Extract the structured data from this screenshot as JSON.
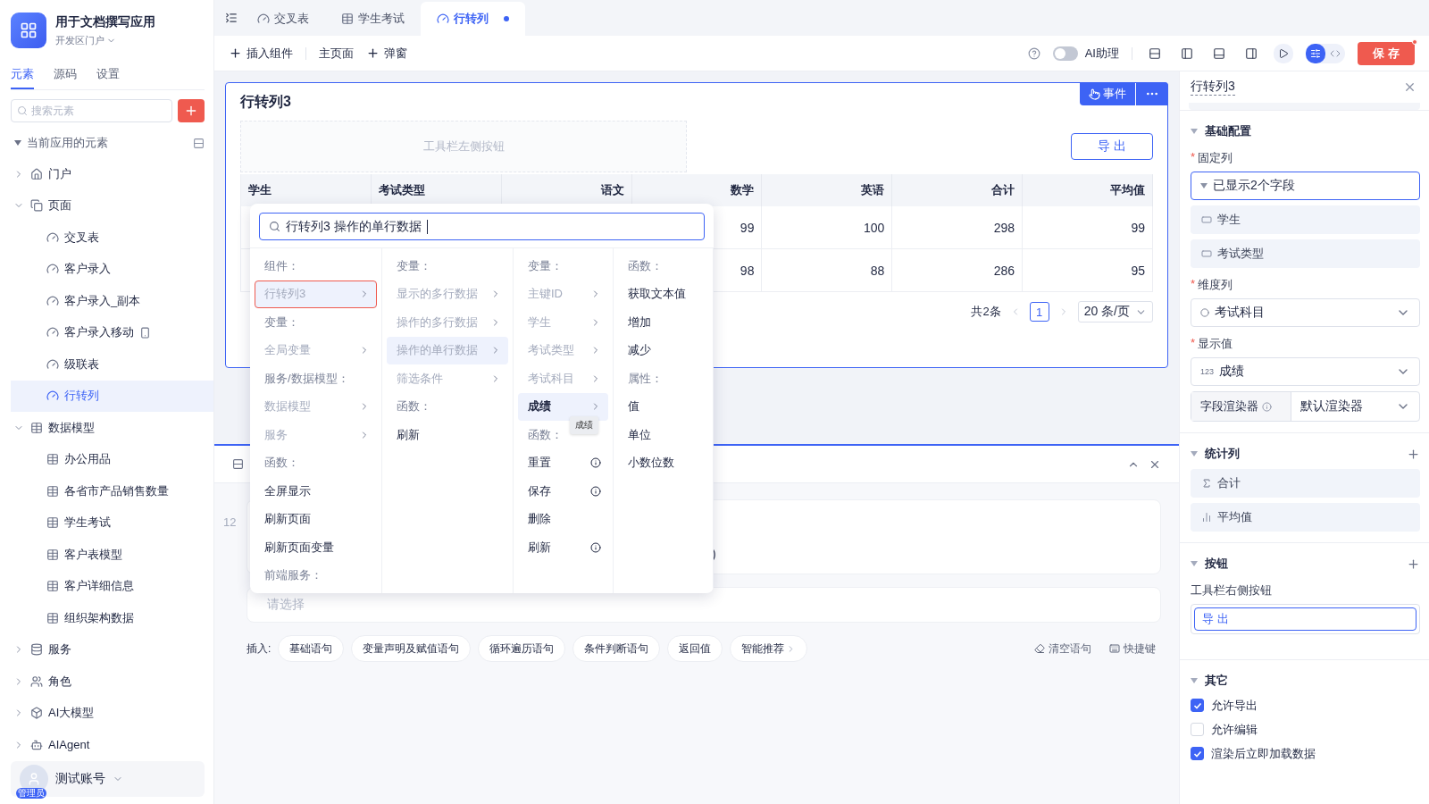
{
  "app": {
    "title": "用于文档撰写应用",
    "portal": "开发区门户"
  },
  "sidebar_tabs": [
    {
      "label": "元素",
      "selected": true
    },
    {
      "label": "源码",
      "selected": false
    },
    {
      "label": "设置",
      "selected": false
    }
  ],
  "search": {
    "placeholder": "搜索元素"
  },
  "tree_title": "当前应用的元素",
  "tree": [
    {
      "label": "门户",
      "kind": "home",
      "expanded": false
    },
    {
      "label": "页面",
      "kind": "pages",
      "expanded": true,
      "children": [
        {
          "label": "交叉表",
          "selected": false,
          "mobile": false
        },
        {
          "label": "客户录入",
          "selected": false,
          "mobile": false
        },
        {
          "label": "客户录入_副本",
          "selected": false,
          "mobile": false
        },
        {
          "label": "客户录入移动",
          "selected": false,
          "mobile": true
        },
        {
          "label": "级联表",
          "selected": false,
          "mobile": false
        },
        {
          "label": "行转列",
          "selected": true,
          "mobile": false
        }
      ]
    },
    {
      "label": "数据模型",
      "kind": "models",
      "expanded": true,
      "children": [
        {
          "label": "办公用品",
          "selected": false,
          "mobile": false
        },
        {
          "label": "各省市产品销售数量",
          "selected": false,
          "mobile": false
        },
        {
          "label": "学生考试",
          "selected": false,
          "mobile": false
        },
        {
          "label": "客户表模型",
          "selected": false,
          "mobile": false
        },
        {
          "label": "客户详细信息",
          "selected": false,
          "mobile": false
        },
        {
          "label": "组织架构数据",
          "selected": false,
          "mobile": false
        }
      ]
    },
    {
      "label": "服务",
      "kind": "services",
      "expanded": false
    },
    {
      "label": "角色",
      "kind": "roles",
      "expanded": false
    },
    {
      "label": "AI大模型",
      "kind": "ai_models",
      "expanded": false
    },
    {
      "label": "AIAgent",
      "kind": "agents",
      "expanded": false
    }
  ],
  "user": {
    "name": "测试账号",
    "role": "管理员"
  },
  "editor_tabs": [
    {
      "label": "交叉表",
      "kind": "page",
      "selected": false,
      "modified": false
    },
    {
      "label": "学生考试",
      "kind": "model",
      "selected": false,
      "modified": false
    },
    {
      "label": "行转列",
      "kind": "page",
      "selected": true,
      "modified": true
    }
  ],
  "toolbar": {
    "insert": "插入组件",
    "main_page": "主页面",
    "popup": "弹窗",
    "ai_label": "AI助理",
    "ai_on": false,
    "save": "保 存"
  },
  "component": {
    "title": "行转列3",
    "event_button": "事件",
    "toolbar_left": "工具栏左侧按钮",
    "export_button": "导 出",
    "columns": [
      "学生",
      "考试类型",
      "语文",
      "数学",
      "英语",
      "合计",
      "平均值"
    ],
    "rows": [
      {
        "cells": [
          null,
          null,
          null,
          "99",
          "100",
          "298",
          "99"
        ]
      },
      {
        "cells": [
          null,
          null,
          null,
          "98",
          "88",
          "286",
          "95"
        ]
      }
    ],
    "pagination": {
      "total": "共2条",
      "pages": [
        {
          "label": "1",
          "selected": true
        }
      ],
      "page_size": "20 条/页"
    }
  },
  "logic_panel": {
    "line_number": "12",
    "code_fragment": ")",
    "select_placeholder": "请选择",
    "insert_label": "插入:",
    "insert_buttons": [
      {
        "label": "基础语句",
        "submenu": false
      },
      {
        "label": "变量声明及赋值语句",
        "submenu": false
      },
      {
        "label": "循环遍历语句",
        "submenu": false
      },
      {
        "label": "条件判断语句",
        "submenu": false
      },
      {
        "label": "返回值",
        "submenu": false
      },
      {
        "label": "智能推荐",
        "submenu": true
      }
    ],
    "clear": "清空语句",
    "shortcut": "快捷键"
  },
  "picker": {
    "query": "行转列3 操作的单行数据",
    "tooltip": "成绩",
    "columns": [
      [
        {
          "kind": "heading",
          "label": "组件："
        },
        {
          "kind": "item",
          "label": "行转列3",
          "disabled": true,
          "selected": true,
          "submenu": true,
          "info": false,
          "outlined": true
        },
        {
          "kind": "heading",
          "label": "变量："
        },
        {
          "kind": "item",
          "label": "全局变量",
          "disabled": true,
          "selected": false,
          "submenu": true,
          "info": false,
          "outlined": false
        },
        {
          "kind": "heading",
          "label": "服务/数据模型："
        },
        {
          "kind": "item",
          "label": "数据模型",
          "disabled": true,
          "selected": false,
          "submenu": true,
          "info": false,
          "outlined": false
        },
        {
          "kind": "item",
          "label": "服务",
          "disabled": true,
          "selected": false,
          "submenu": true,
          "info": false,
          "outlined": false
        },
        {
          "kind": "heading",
          "label": "函数："
        },
        {
          "kind": "item",
          "label": "全屏显示",
          "disabled": false,
          "selected": false,
          "submenu": false,
          "info": false,
          "outlined": false
        },
        {
          "kind": "item",
          "label": "刷新页面",
          "disabled": false,
          "selected": false,
          "submenu": false,
          "info": false,
          "outlined": false
        },
        {
          "kind": "item",
          "label": "刷新页面变量",
          "disabled": false,
          "selected": false,
          "submenu": false,
          "info": false,
          "outlined": false
        },
        {
          "kind": "heading",
          "label": "前端服务："
        }
      ],
      [
        {
          "kind": "heading",
          "label": "变量："
        },
        {
          "kind": "item",
          "label": "显示的多行数据",
          "disabled": true,
          "selected": false,
          "submenu": true,
          "info": false,
          "outlined": false
        },
        {
          "kind": "item",
          "label": "操作的多行数据",
          "disabled": true,
          "selected": false,
          "submenu": true,
          "info": false,
          "outlined": false
        },
        {
          "kind": "item",
          "label": "操作的单行数据",
          "disabled": true,
          "selected": true,
          "submenu": true,
          "info": false,
          "outlined": false
        },
        {
          "kind": "item",
          "label": "筛选条件",
          "disabled": true,
          "selected": false,
          "submenu": true,
          "info": false,
          "outlined": false
        },
        {
          "kind": "heading",
          "label": "函数："
        },
        {
          "kind": "item",
          "label": "刷新",
          "disabled": false,
          "selected": false,
          "submenu": false,
          "info": false,
          "outlined": false
        }
      ],
      [
        {
          "kind": "heading",
          "label": "变量："
        },
        {
          "kind": "item",
          "label": "主键ID",
          "disabled": true,
          "selected": false,
          "submenu": true,
          "info": false,
          "outlined": false
        },
        {
          "kind": "item",
          "label": "学生",
          "disabled": true,
          "selected": false,
          "submenu": true,
          "info": false,
          "outlined": false
        },
        {
          "kind": "item",
          "label": "考试类型",
          "disabled": true,
          "selected": false,
          "submenu": true,
          "info": false,
          "outlined": false
        },
        {
          "kind": "item",
          "label": "考试科目",
          "disabled": true,
          "selected": false,
          "submenu": true,
          "info": false,
          "outlined": false
        },
        {
          "kind": "item",
          "label": "成绩",
          "disabled": false,
          "selected": true,
          "submenu": true,
          "info": false,
          "outlined": false
        },
        {
          "kind": "heading",
          "label": "函数："
        },
        {
          "kind": "item",
          "label": "重置",
          "disabled": false,
          "selected": false,
          "submenu": false,
          "info": true,
          "outlined": false
        },
        {
          "kind": "item",
          "label": "保存",
          "disabled": false,
          "selected": false,
          "submenu": false,
          "info": true,
          "outlined": false
        },
        {
          "kind": "item",
          "label": "删除",
          "disabled": false,
          "selected": false,
          "submenu": false,
          "info": false,
          "outlined": false
        },
        {
          "kind": "item",
          "label": "刷新",
          "disabled": false,
          "selected": false,
          "submenu": false,
          "info": true,
          "outlined": false
        }
      ],
      [
        {
          "kind": "heading",
          "label": "函数："
        },
        {
          "kind": "item",
          "label": "获取文本值",
          "disabled": false,
          "selected": false,
          "submenu": false,
          "info": false,
          "outlined": false
        },
        {
          "kind": "item",
          "label": "增加",
          "disabled": false,
          "selected": false,
          "submenu": false,
          "info": false,
          "outlined": false
        },
        {
          "kind": "item",
          "label": "减少",
          "disabled": false,
          "selected": false,
          "submenu": false,
          "info": false,
          "outlined": false
        },
        {
          "kind": "heading",
          "label": "属性："
        },
        {
          "kind": "item",
          "label": "值",
          "disabled": false,
          "selected": false,
          "submenu": false,
          "info": false,
          "outlined": false
        },
        {
          "kind": "item",
          "label": "单位",
          "disabled": false,
          "selected": false,
          "submenu": false,
          "info": false,
          "outlined": false
        },
        {
          "kind": "item",
          "label": "小数位数",
          "disabled": false,
          "selected": false,
          "submenu": false,
          "info": false,
          "outlined": false
        }
      ]
    ]
  },
  "inspector": {
    "title": "行转列3",
    "basic": {
      "title": "基础配置",
      "fixed": {
        "label": "固定列",
        "marker": "*",
        "summary": "已显示2个字段",
        "items": [
          "学生",
          "考试类型"
        ]
      },
      "dimension": {
        "label": "维度列",
        "marker": "*",
        "value": "考试科目"
      },
      "display": {
        "label": "显示值",
        "marker": "*",
        "value": "成绩",
        "value_prefix": "123",
        "renderer_label": "字段渲染器",
        "renderer_value": "默认渲染器"
      }
    },
    "stats": {
      "title": "统计列",
      "items": [
        {
          "label": "合计",
          "kind": "sum"
        },
        {
          "label": "平均值",
          "kind": "average"
        }
      ]
    },
    "buttons": {
      "title": "按钮",
      "group_label": "工具栏右侧按钮",
      "items": [
        "导 出"
      ]
    },
    "other": {
      "title": "其它",
      "options": [
        {
          "label": "允许导出",
          "checked": true
        },
        {
          "label": "允许编辑",
          "checked": false
        },
        {
          "label": "渲染后立即加载数据",
          "checked": true
        }
      ]
    }
  }
}
